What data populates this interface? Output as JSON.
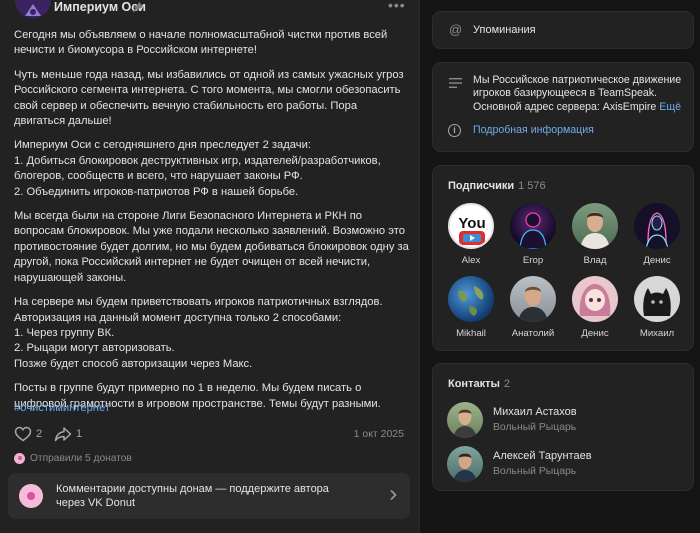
{
  "post": {
    "group_name": "Империум Оси",
    "paragraphs": [
      "Сегодня мы объявляем о начале полномасштабной чистки против всей нечисти и биомусора в Российском интернете!",
      "Чуть меньше года назад, мы избавились от одной из самых ужасных угроз Российского сегмента интернета. С того момента, мы смогли обезопасить свой сервер и обеспечить вечную стабильность его работы. Пора двигаться дальше!",
      "Империум Оси с сегодняшнего дня преследует 2 задачи:\n1. Добиться блокировок деструктивных игр, издателей/разработчиков, блогеров, сообществ и всего, что нарушает законы РФ.\n2. Объединить игроков-патриотов РФ в нашей борьбе.",
      "Мы всегда были на стороне Лиги Безопасного Интернета и РКН по вопросам блокировок. Мы уже подали несколько заявлений. Возможно это противостояние будет долгим, но мы будем добиваться блокировок одну за другой, пока Российский интернет не будет очищен от всей нечисти, нарушающей законы.",
      "На сервере мы будем приветствовать игроков патриотичных взглядов. Авторизация на данный момент доступна только 2 способами:\n1. Через группу ВК.\n2. Рыцари могут авторизовать.\nПозже будет способ авторизации через Макс.",
      "Посты в группе будут примерно по 1 в неделю. Мы будем писать о цифровой грамотности в игровом пространстве. Темы будут разными."
    ],
    "hashtag": "#очистиминтернет",
    "likes": "2",
    "shares": "1",
    "date": "1 окт 2025",
    "donuts_text": "Отправили 5 донатов",
    "donut_banner": "Комментарии доступны донам — поддержите автора через VK Donut"
  },
  "sidebar": {
    "mentions_label": "Упоминания",
    "about_text": "Мы Российское патриотическое движение игроков базирующееся в TeamSpeak. Основной адрес сервера: AxisEmpire",
    "about_more": "Ещё",
    "info_link": "Подробная информация",
    "subscribers_title": "Подписчики",
    "subscribers_count": "1 576",
    "subscribers": [
      {
        "name": "Alex"
      },
      {
        "name": "Егор"
      },
      {
        "name": "Влад"
      },
      {
        "name": "Денис"
      },
      {
        "name": "Mikhail"
      },
      {
        "name": "Анатолий"
      },
      {
        "name": "Денис"
      },
      {
        "name": "Михаил"
      }
    ],
    "contacts_title": "Контакты",
    "contacts_count": "2",
    "contacts": [
      {
        "name": "Михаил Астахов",
        "role": "Вольный Рыцарь"
      },
      {
        "name": "Алексей Тарунтаев",
        "role": "Вольный Рыцарь"
      }
    ],
    "avatar_icons": [
      "youtube-logo",
      "neon-figure",
      "photo-man",
      "neon-portrait",
      "earth-planet",
      "photo-man",
      "anime-girl",
      "black-cat"
    ]
  },
  "colors": {
    "background": "#141414",
    "card": "#222222",
    "text": "#e1e3e6",
    "muted": "#8a8a8a",
    "link": "#71aaeb",
    "donut": "#f7bcd9"
  }
}
